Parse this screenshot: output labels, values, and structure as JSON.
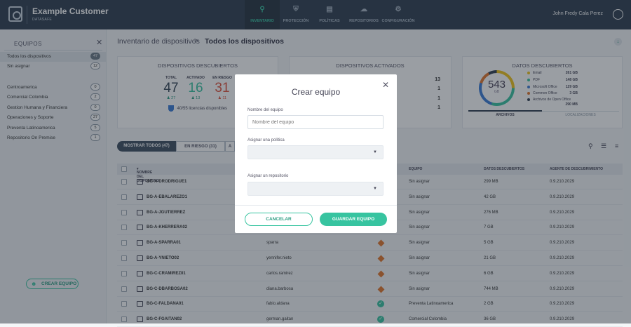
{
  "app": {
    "title": "Example Customer",
    "subtitle": "DATASAFE",
    "user": "John Fredy Cala Perez"
  },
  "nav": [
    {
      "label": "INVENTARIO",
      "icon": "search-icon",
      "active": true
    },
    {
      "label": "PROTECCIÓN",
      "icon": "shield-icon",
      "active": false
    },
    {
      "label": "POLÍTICAS",
      "icon": "policy-icon",
      "active": false
    },
    {
      "label": "REPOSITORIOS",
      "icon": "cloud-icon",
      "active": false
    },
    {
      "label": "CONFIGURACIÓN",
      "icon": "gear-icon",
      "active": false
    }
  ],
  "sidebar": {
    "title": "EQUIPOS",
    "items_top": [
      {
        "label": "Todos los dispositivos",
        "count": "47",
        "selected": true
      },
      {
        "label": "Sin asignar",
        "count": "12",
        "selected": false
      }
    ],
    "items": [
      {
        "label": "Centroamerica",
        "count": "0"
      },
      {
        "label": "Comercial Colombia",
        "count": "2"
      },
      {
        "label": "Gestion Humana y Financiera",
        "count": "0"
      },
      {
        "label": "Operaciones y Soporte",
        "count": "27"
      },
      {
        "label": "Preventa Latinoamerica",
        "count": "5"
      },
      {
        "label": "Repositorio On Premise",
        "count": "1"
      }
    ],
    "create_button": "CREAR EQUIPO"
  },
  "breadcrumb": {
    "parent": "Inventario de dispositivos",
    "sep": ">",
    "current": "Todos los dispositivos"
  },
  "discovered": {
    "title": "DISPOSITIVOS DESCUBIERTOS",
    "stats": [
      {
        "label": "TOTAL",
        "value": "47",
        "sub": "27",
        "color": "#334455"
      },
      {
        "label": "ACTIVADO",
        "value": "16",
        "sub": "13",
        "color": "#37c4a0"
      },
      {
        "label": "EN RIESGO",
        "value": "31",
        "sub": "11",
        "color": "#e0533d"
      }
    ],
    "licenses": "40/55 licencias disponibles"
  },
  "activated": {
    "title": "DISPOSITIVOS ACTIVADOS",
    "rows": [
      "13",
      "1",
      "1",
      "1"
    ]
  },
  "data": {
    "title": "DATOS DESCUBIERTOS",
    "total": "543",
    "unit": "GB",
    "legend": [
      {
        "label": "Email",
        "value": "261 GB",
        "color": "#f0c419"
      },
      {
        "label": "PDF",
        "value": "148 GB",
        "color": "#37c4a0"
      },
      {
        "label": "Microsoft Office",
        "value": "129 GB",
        "color": "#3a7bd5"
      },
      {
        "label": "Common Office",
        "value": "3 GB",
        "color": "#e2762b"
      },
      {
        "label": "Archivos de Open Office",
        "value": "290 MB",
        "color": "#2e3d4f"
      }
    ],
    "tab_files": "ARCHIVOS",
    "tab_locations": "LOCALIZACIONES"
  },
  "filters": [
    {
      "label": "MOSTRAR TODOS (47)",
      "active": true
    },
    {
      "label": "EN RIESGO (31)",
      "active": false
    },
    {
      "label": "A",
      "active": false
    }
  ],
  "table": {
    "headers": {
      "name": "NOMBRE DEL DISPOSITIVO",
      "team": "EQUIPO",
      "data": "DATOS DESCUBIERTOS",
      "agent": "AGENTE DE DESCUBRIMIENTO"
    },
    "rows": [
      {
        "name": "BG-A-DRODRIGUE1",
        "user": "",
        "status": "",
        "team": "Sin asignar",
        "data": "299 MB",
        "agent": "0.9.210.2029"
      },
      {
        "name": "BG-A-EBALAREZO1",
        "user": "",
        "status": "",
        "team": "Sin asignar",
        "data": "42 GB",
        "agent": "0.9.210.2029"
      },
      {
        "name": "BG-A-JGUTIERREZ",
        "user": "",
        "status": "",
        "team": "Sin asignar",
        "data": "276 MB",
        "agent": "0.9.210.2029"
      },
      {
        "name": "BG-A-KHERRERA02",
        "user": "",
        "status": "",
        "team": "Sin asignar",
        "data": "7 GB",
        "agent": "0.9.210.2029"
      },
      {
        "name": "BG-A-SPARRA01",
        "user": "sparra",
        "status": "risk",
        "team": "Sin asignar",
        "data": "5 GB",
        "agent": "0.9.210.2029"
      },
      {
        "name": "BG-A-YNIETO02",
        "user": "yennifer.nieto",
        "status": "risk",
        "team": "Sin asignar",
        "data": "21 GB",
        "agent": "0.9.210.2029"
      },
      {
        "name": "BG-C-CRAMIREZ01",
        "user": "carlos.ramirez",
        "status": "risk",
        "team": "Sin asignar",
        "data": "6 GB",
        "agent": "0.9.210.2029"
      },
      {
        "name": "BG-C-DBARBOSA02",
        "user": "diana.barbosa",
        "status": "risk",
        "team": "Sin asignar",
        "data": "744 MB",
        "agent": "0.9.210.2029"
      },
      {
        "name": "BG-C-FALDANA01",
        "user": "fabio.aldana",
        "status": "ok",
        "team": "Preventa Latinoamerica",
        "data": "2 GB",
        "agent": "0.9.210.2029"
      },
      {
        "name": "BG-C-FGAITAN02",
        "user": "german.gaitan",
        "status": "ok",
        "team": "Comercial Colombia",
        "data": "36 GB",
        "agent": "0.9.210.2029"
      }
    ]
  },
  "modal": {
    "title": "Crear equipo",
    "name_label": "Nombre del equipo",
    "name_placeholder": "Nombre del equipo",
    "policy_label": "Asignar una política",
    "repo_label": "Asignar un repositorio",
    "cancel": "CANCELAR",
    "save": "GUARDAR EQUIPO"
  }
}
